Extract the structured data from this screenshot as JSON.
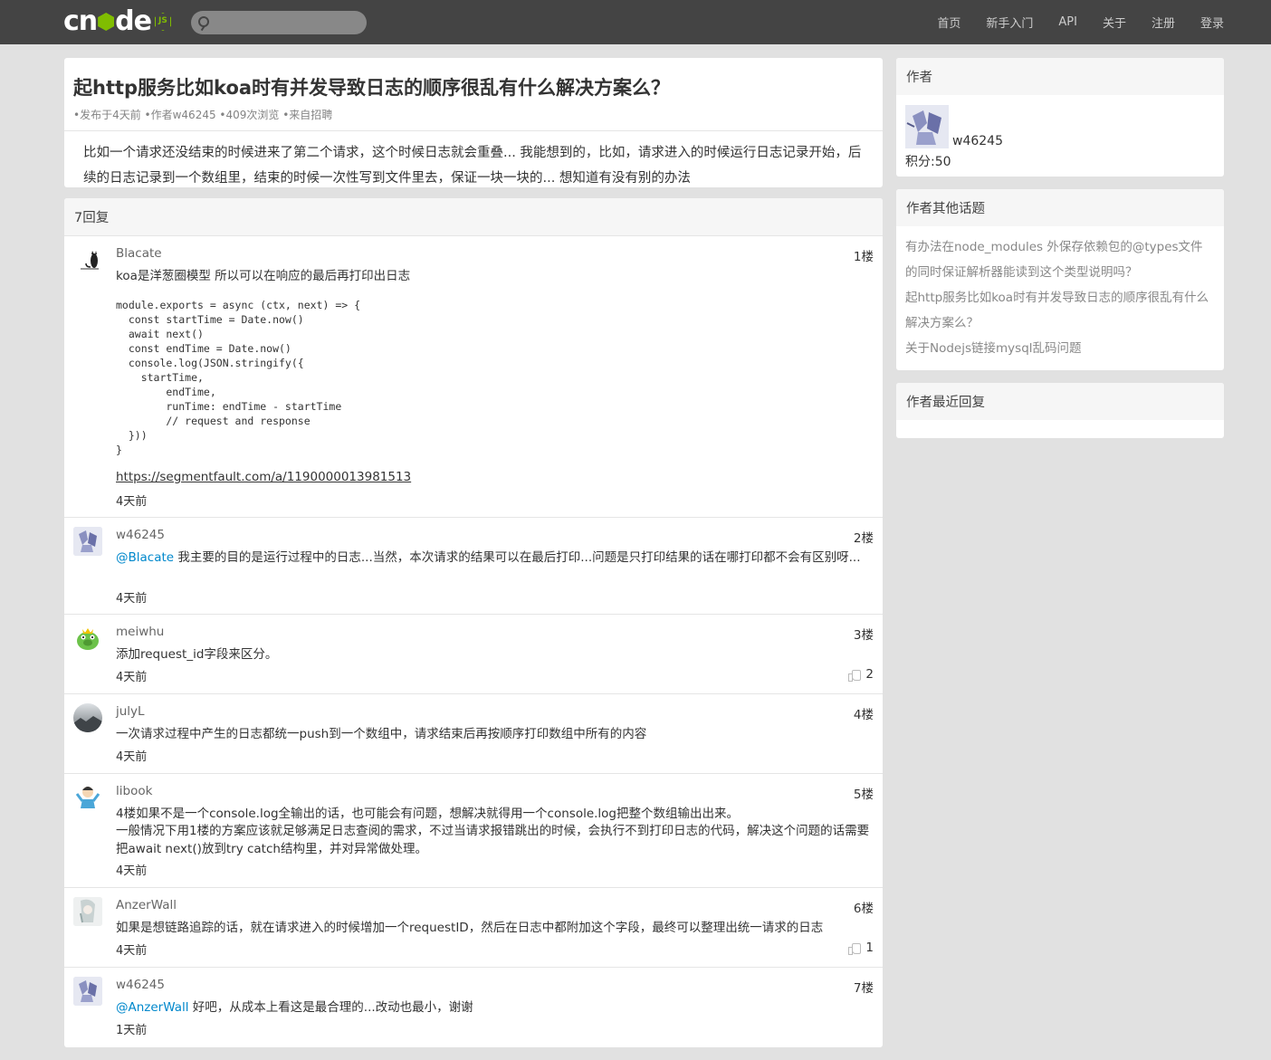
{
  "navbar": {
    "logo_text_1": "cn",
    "logo_text_2": "de",
    "logo_js": "JS",
    "search_placeholder": "",
    "links": [
      "首页",
      "新手入门",
      "API",
      "关于",
      "注册",
      "登录"
    ]
  },
  "topic": {
    "title": "起http服务比如koa时有并发导致日志的顺序很乱有什么解决方案么？",
    "meta": "•发布于4天前 •作者w46245 •409次浏览 •来自招聘",
    "content": "比如一个请求还没结束的时候进来了第二个请求，这个时候日志就会重叠... 我能想到的，比如，请求进入的时候运行日志记录开始，后续的日志记录到一个数组里，结束的时候一次性写到文件里去，保证一块一块的... 想知道有没有别的办法"
  },
  "replies": {
    "header": "7回复",
    "items": [
      {
        "name": "Blacate",
        "floor": "1楼",
        "text": "koa是洋葱圈模型 所以可以在响应的最后再打印出日志",
        "code": "module.exports = async (ctx, next) => {\n  const startTime = Date.now()\n  await next()\n  const endTime = Date.now()\n  console.log(JSON.stringify({\n    startTime,\n        endTime,\n        runTime: endTime - startTime\n        // request and response\n  }))\n}",
        "link": "https://segmentfault.com/a/1190000013981513",
        "time": "4天前"
      },
      {
        "name": "w46245",
        "floor": "2楼",
        "mention": "@Blacate",
        "text": " 我主要的目的是运行过程中的日志...当然，本次请求的结果可以在最后打印...问题是只打印结果的话在哪打印都不会有区别呀...",
        "time": "4天前"
      },
      {
        "name": "meiwhu",
        "floor": "3楼",
        "text": "添加request_id字段来区分。",
        "time": "4天前",
        "likes": "2"
      },
      {
        "name": "julyL",
        "floor": "4楼",
        "text": "一次请求过程中产生的日志都统一push到一个数组中，请求结束后再按顺序打印数组中所有的内容",
        "time": "4天前"
      },
      {
        "name": "libook",
        "floor": "5楼",
        "text": "4楼如果不是一个console.log全输出的话，也可能会有问题，想解决就得用一个console.log把整个数组输出出来。",
        "text2": "一般情况下用1楼的方案应该就足够满足日志查阅的需求，不过当请求报错跳出的时候，会执行不到打印日志的代码，解决这个问题的话需要把await next()放到try catch结构里，并对异常做处理。",
        "time": "4天前"
      },
      {
        "name": "AnzerWall",
        "floor": "6楼",
        "text": "如果是想链路追踪的话，就在请求进入的时候增加一个requestID，然后在日志中都附加这个字段，最终可以整理出统一请求的日志",
        "time": "4天前",
        "likes": "1"
      },
      {
        "name": "w46245",
        "floor": "7楼",
        "mention": "@AnzerWall",
        "text": " 好吧，从成本上看这是最合理的...改动也最小，谢谢",
        "time": "1天前"
      }
    ]
  },
  "sidebar": {
    "author_head": "作者",
    "author_name": "w46245",
    "author_score": "积分:50",
    "topics_head": "作者其他话题",
    "topics": [
      "有办法在node_modules 外保存依赖包的@types文件的同时保证解析器能读到这个类型说明吗？",
      "起http服务比如koa时有并发导致日志的顺序很乱有什么解决方案么？",
      "关于Nodejs链接mysql乱码问题"
    ],
    "recent_head": "作者最近回复"
  }
}
